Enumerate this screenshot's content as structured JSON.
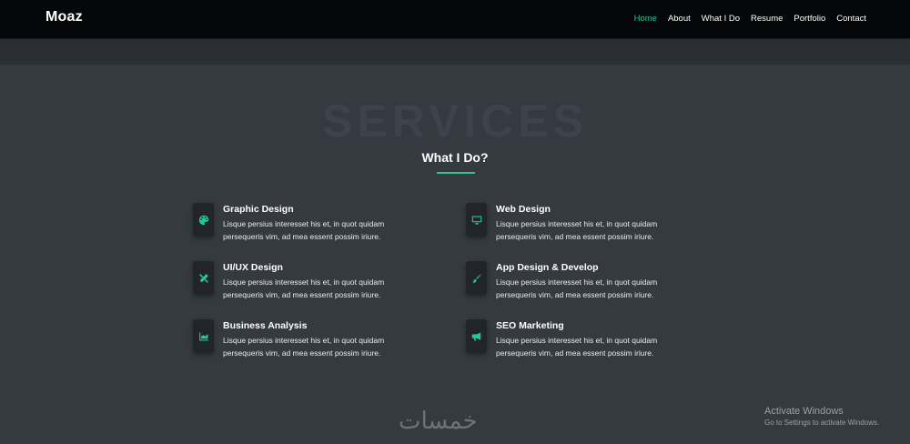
{
  "header": {
    "brand": "Moaz",
    "nav": [
      "Home",
      "About",
      "What I Do",
      "Resume",
      "Portfolio",
      "Contact"
    ],
    "active_nav": "Home"
  },
  "section": {
    "bg_title": "SERVICES",
    "title": "What I Do?"
  },
  "services": [
    {
      "title": "Graphic Design",
      "icon": "palette-icon",
      "desc": "Lisque persius interesset his et, in quot quidam persequeris vim, ad mea essent possim iriure."
    },
    {
      "title": "Web Design",
      "icon": "desktop-icon",
      "desc": "Lisque persius interesset his et, in quot quidam persequeris vim, ad mea essent possim iriure."
    },
    {
      "title": "UI/UX Design",
      "icon": "pencil-ruler-icon",
      "desc": "Lisque persius interesset his et, in quot quidam persequeris vim, ad mea essent possim iriure."
    },
    {
      "title": "App Design & Develop",
      "icon": "paint-brush-icon",
      "desc": "Lisque persius interesset his et, in quot quidam persequeris vim, ad mea essent possim iriure."
    },
    {
      "title": "Business Analysis",
      "icon": "chart-area-icon",
      "desc": "Lisque persius interesset his et, in quot quidam persequeris vim, ad mea essent possim iriure."
    },
    {
      "title": "SEO Marketing",
      "icon": "bullhorn-icon",
      "desc": "Lisque persius interesset his et, in quot quidam persequeris vim, ad mea essent possim iriure."
    }
  ],
  "watermark": {
    "logo_text": "خمسات",
    "activate_title": "Activate Windows",
    "activate_sub": "Go to Settings to activate Windows."
  },
  "colors": {
    "accent": "#20c997",
    "background": "#343a40",
    "nav_bg": "#050607"
  }
}
